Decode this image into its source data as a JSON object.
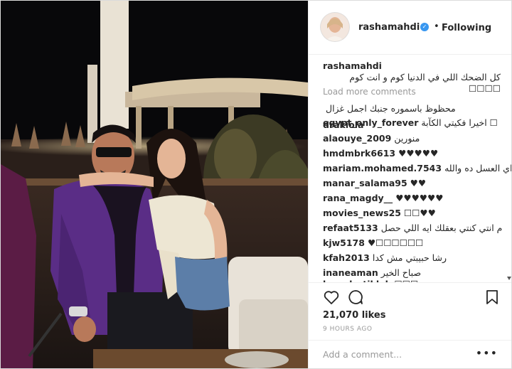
{
  "post": {
    "username": "rashamahdi",
    "verified_mark": "✓",
    "separator": "•",
    "follow_status": "Following",
    "caption_user": "rashamahdi",
    "caption_text": "كل الضحك اللي في الدنيا كوم و انت كوم ☐☐☐☐",
    "load_more": "Load more comments",
    "likes": "21,070 likes",
    "time_ago": "9 HOURS AGO",
    "add_comment_placeholder": "Add a comment...",
    "more_options": "•••"
  },
  "comments": [
    {
      "user": "",
      "text": "محظوظ باسموره جنبك اجمل غزال"
    },
    {
      "user": "drakiola",
      "text": ""
    },
    {
      "user": "egypt_only_forever",
      "text": "اخيرا فكيتي الكآبة ☐"
    },
    {
      "user": "alaouye_2009",
      "text": "منورين"
    },
    {
      "user": "hmdmbrk6613",
      "text": "♥♥♥♥♥"
    },
    {
      "user": "mariam.mohamed.7543",
      "text": "اي العسل ده والله"
    },
    {
      "user": "manar_salama95",
      "text": "♥♥"
    },
    {
      "user": "rana_magdy__",
      "text": "♥♥♥♥♥♥"
    },
    {
      "user": "movies_news25",
      "text": "☐☐♥♥"
    },
    {
      "user": "refaat5133",
      "text": "م انتي كنتي بعقلك ايه اللي حصل"
    },
    {
      "user": "kjw5178",
      "text": "♥☐☐☐☐☐☐"
    },
    {
      "user": "kfah2013",
      "text": "رشا حبيبتي مش كدا"
    },
    {
      "user": "inaneaman",
      "text": "صباح الخير"
    },
    {
      "user": "brandcstikleb",
      "text": "☐☐☐"
    }
  ],
  "icons": {
    "like": "heart-icon",
    "comment": "comment-icon",
    "save": "bookmark-icon"
  },
  "colors": {
    "verified": "#3897f0",
    "text": "#262626",
    "muted": "#999999"
  }
}
